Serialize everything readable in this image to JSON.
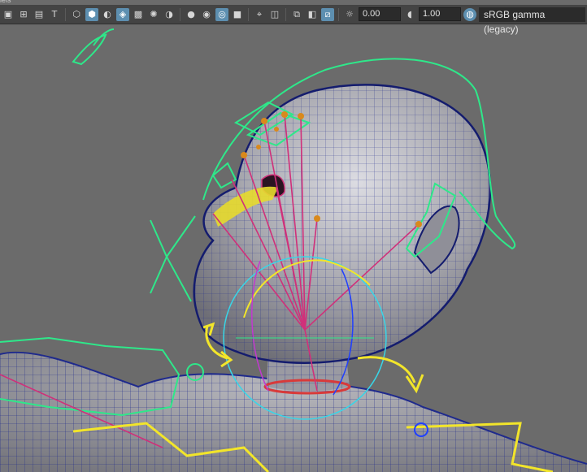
{
  "panel": {
    "menu_label": "iels"
  },
  "toolbar": {
    "buttons": [
      {
        "icon": "square-dot-icon"
      },
      {
        "icon": "grid-icon"
      },
      {
        "icon": "film-gate-icon"
      },
      {
        "icon": "text-icon",
        "label": "T"
      },
      {
        "icon": "wireframe-cube-icon"
      },
      {
        "icon": "shaded-cube-icon",
        "active": true
      },
      {
        "icon": "texture-sphere-icon"
      },
      {
        "icon": "wireframe-on-shaded-icon",
        "active": true
      },
      {
        "icon": "checker-icon"
      },
      {
        "icon": "light-icon"
      },
      {
        "icon": "shadows-icon"
      },
      {
        "icon": "ambient-occlusion-icon"
      },
      {
        "icon": "motion-blur-icon"
      },
      {
        "icon": "anti-alias-icon",
        "active": true
      },
      {
        "icon": "depth-of-field-icon"
      },
      {
        "icon": "select-camera-icon"
      },
      {
        "icon": "isolate-icon"
      },
      {
        "icon": "xray-icon"
      },
      {
        "icon": "xray-joints-icon"
      },
      {
        "icon": "exposure-icon"
      },
      {
        "icon": "gamma-icon"
      },
      {
        "icon": "color-management-icon"
      }
    ],
    "exposure_value": "0.00",
    "gamma_value": "1.00",
    "color_space": "sRGB gamma (legacy)"
  },
  "colors": {
    "background": "#6b6b6b",
    "mesh_fill": "#a8a8ae",
    "wire": "#1f2a8c",
    "control_green": "#2ee88a",
    "control_yellow": "#f2e52a",
    "aim_magenta": "#d0307a",
    "pivot_orange": "#d9891c",
    "cyan_circle": "#38d6e8",
    "accent": "#5d8fb0"
  }
}
